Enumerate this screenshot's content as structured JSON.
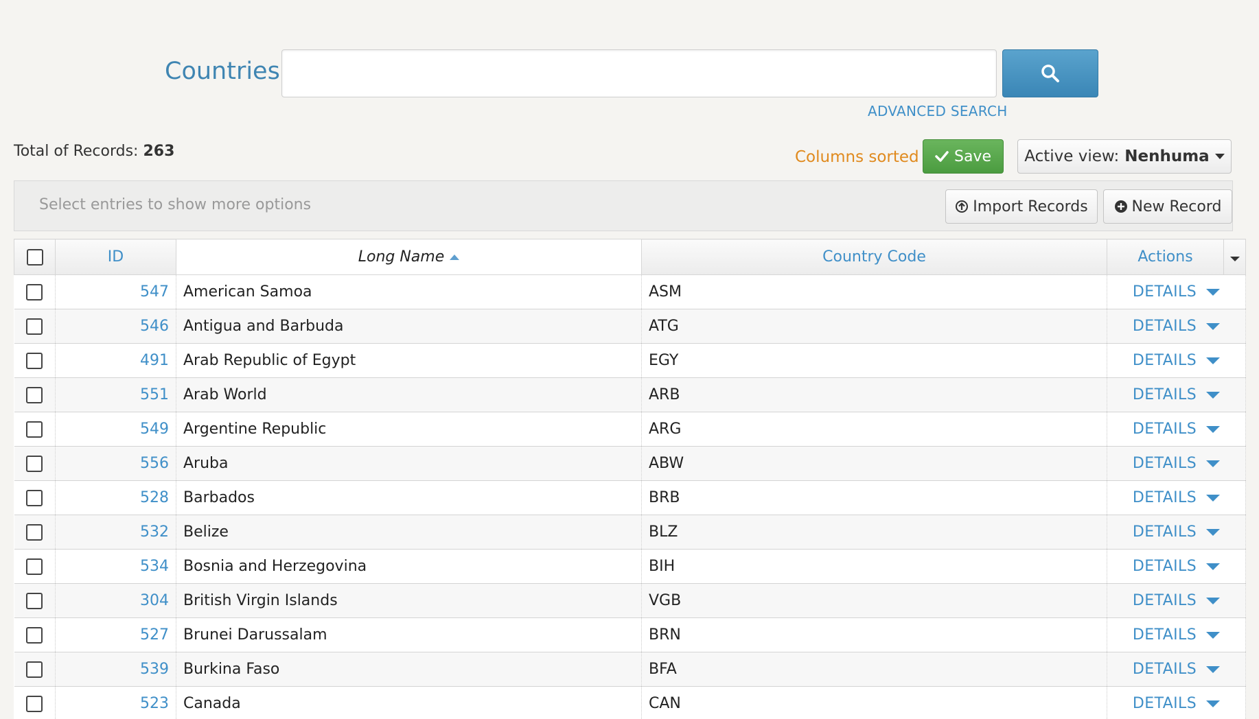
{
  "search": {
    "title": "Countries",
    "value": "",
    "placeholder": "",
    "advanced_label": "ADVANCED SEARCH"
  },
  "toolbar": {
    "total_label": "Total of Records:",
    "total_count": "263",
    "columns_sorted": "Columns sorted",
    "save_label": "Save",
    "active_view_label": "Active view:",
    "active_view_value": "Nenhuma"
  },
  "selection": {
    "hint": "Select entries to show more options",
    "import_label": "Import Records",
    "new_record_label": "New Record"
  },
  "table": {
    "columns": [
      "ID",
      "Long Name",
      "Country Code",
      "Actions"
    ],
    "rows": [
      {
        "id": "547",
        "name": "American Samoa",
        "code": "ASM",
        "action": "DETAILS"
      },
      {
        "id": "546",
        "name": "Antigua and Barbuda",
        "code": "ATG",
        "action": "DETAILS"
      },
      {
        "id": "491",
        "name": "Arab Republic of Egypt",
        "code": "EGY",
        "action": "DETAILS"
      },
      {
        "id": "551",
        "name": "Arab World",
        "code": "ARB",
        "action": "DETAILS"
      },
      {
        "id": "549",
        "name": "Argentine Republic",
        "code": "ARG",
        "action": "DETAILS"
      },
      {
        "id": "556",
        "name": "Aruba",
        "code": "ABW",
        "action": "DETAILS"
      },
      {
        "id": "528",
        "name": "Barbados",
        "code": "BRB",
        "action": "DETAILS"
      },
      {
        "id": "532",
        "name": "Belize",
        "code": "BLZ",
        "action": "DETAILS"
      },
      {
        "id": "534",
        "name": "Bosnia and Herzegovina",
        "code": "BIH",
        "action": "DETAILS"
      },
      {
        "id": "304",
        "name": "British Virgin Islands",
        "code": "VGB",
        "action": "DETAILS"
      },
      {
        "id": "527",
        "name": "Brunei Darussalam",
        "code": "BRN",
        "action": "DETAILS"
      },
      {
        "id": "539",
        "name": "Burkina Faso",
        "code": "BFA",
        "action": "DETAILS"
      },
      {
        "id": "523",
        "name": "Canada",
        "code": "CAN",
        "action": "DETAILS"
      }
    ]
  },
  "colors": {
    "link_blue": "#3f8fc8",
    "save_green": "#4b9c40",
    "warning_orange": "#e08a1e",
    "page_bg": "#f5f4f1"
  }
}
